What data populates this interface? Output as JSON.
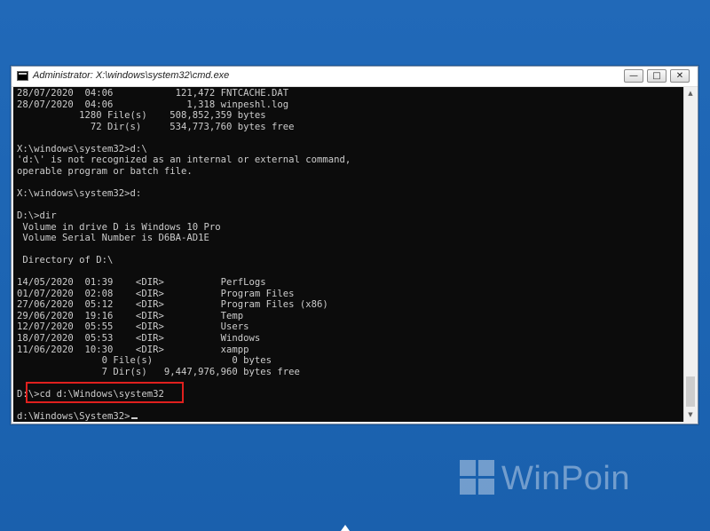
{
  "window": {
    "title": "Administrator: X:\\windows\\system32\\cmd.exe",
    "minimize_glyph": "—",
    "maximize_glyph": "□",
    "close_glyph": "✕"
  },
  "console": {
    "lines": [
      "28/07/2020  04:06           121,472 FNTCACHE.DAT",
      "28/07/2020  04:06             1,318 winpeshl.log",
      "           1280 File(s)    508,852,359 bytes",
      "             72 Dir(s)     534,773,760 bytes free",
      "",
      "X:\\windows\\system32>d:\\",
      "'d:\\' is not recognized as an internal or external command,",
      "operable program or batch file.",
      "",
      "X:\\windows\\system32>d:",
      "",
      "D:\\>dir",
      " Volume in drive D is Windows 10 Pro",
      " Volume Serial Number is D6BA-AD1E",
      "",
      " Directory of D:\\",
      "",
      "14/05/2020  01:39    <DIR>          PerfLogs",
      "01/07/2020  02:08    <DIR>          Program Files",
      "27/06/2020  05:12    <DIR>          Program Files (x86)",
      "29/06/2020  19:16    <DIR>          Temp",
      "12/07/2020  05:55    <DIR>          Users",
      "18/07/2020  05:53    <DIR>          Windows",
      "11/06/2020  10:30    <DIR>          xampp",
      "               0 File(s)              0 bytes",
      "               7 Dir(s)   9,447,976,960 bytes free",
      "",
      "D:\\>cd d:\\Windows\\system32",
      "",
      "d:\\Windows\\System32>"
    ]
  },
  "scrollbar": {
    "up_glyph": "▲",
    "down_glyph": "▼"
  },
  "watermark": {
    "text": "WinPoin"
  },
  "colors": {
    "desktop_bg": "#1e6ab8",
    "console_bg": "#0c0c0c",
    "console_fg": "#cccccc",
    "highlight": "#e0201e"
  }
}
